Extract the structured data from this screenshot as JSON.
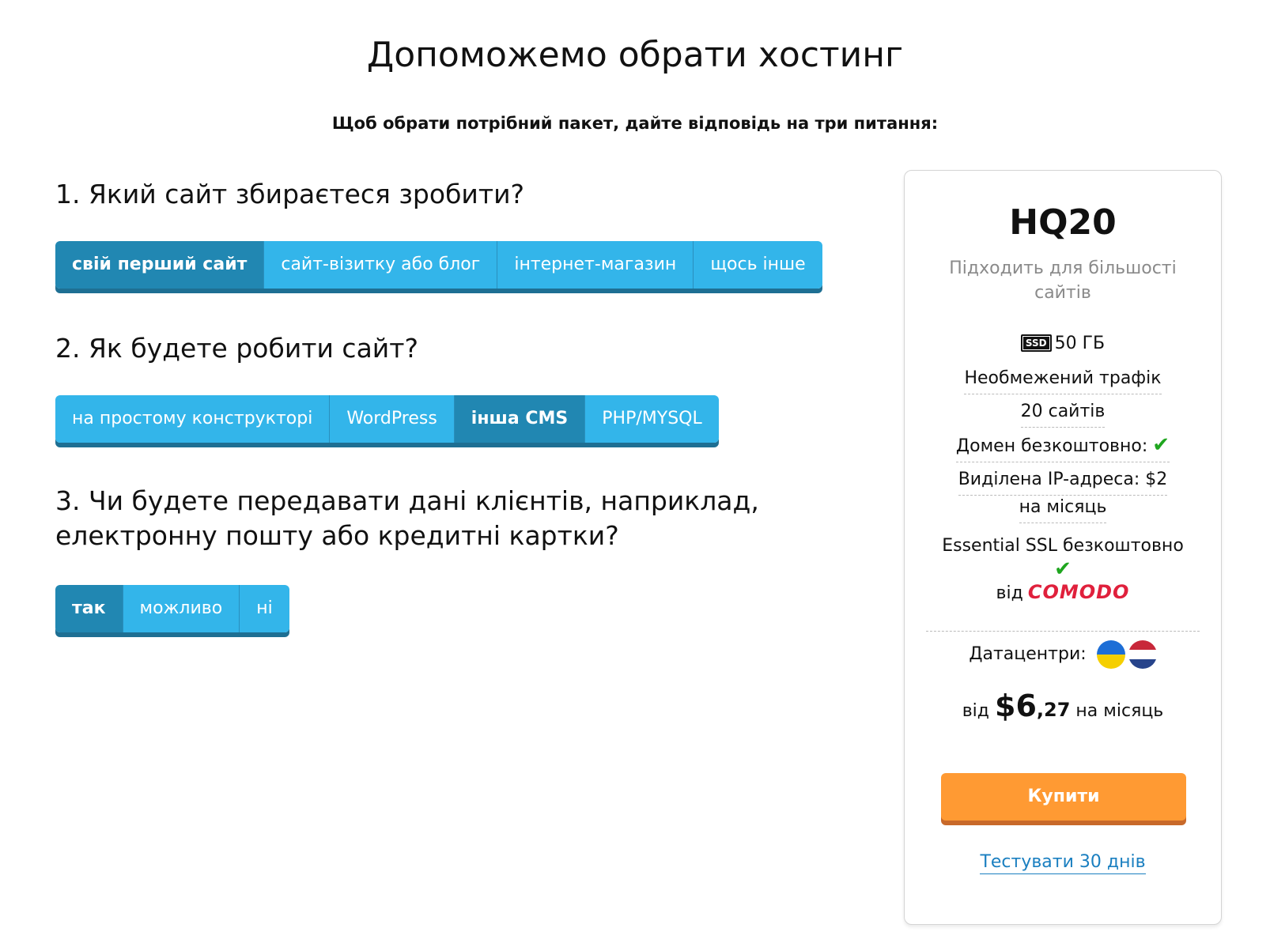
{
  "header": {
    "title": "Допоможемо обрати хостинг",
    "subtitle": "Щоб обрати потрібний пакет, дайте відповідь на три питання:"
  },
  "questions": [
    {
      "label": "1. Який сайт збираєтеся зробити?",
      "options": [
        "свій перший сайт",
        "сайт-візитку або блог",
        "інтернет-магазин",
        "щось інше"
      ],
      "selected": "свій перший сайт"
    },
    {
      "label": "2. Як будете робити сайт?",
      "options": [
        "на простому конструкторі",
        "WordPress",
        "інша CMS",
        "PHP/MYSQL"
      ],
      "selected": "інша CMS"
    },
    {
      "label": "3. Чи будете передавати дані клієнтів, наприклад, електронну пошту або кредитні картки?",
      "options": [
        "так",
        "можливо",
        "ні"
      ],
      "selected": "так"
    }
  ],
  "plan": {
    "name": "HQ20",
    "description": "Підходить для більшості сайтів",
    "ssd_badge": "SSD",
    "storage": "50 ГБ",
    "traffic": "Необмежений трафік",
    "sites": "20 сайтів",
    "domain": "Домен безкоштовно:",
    "ip_line1": "Виділена IP-адреса: $2",
    "ip_line2": "на місяць",
    "ssl": "Essential SSL безкоштовно",
    "ssl_from": "від",
    "ssl_brand": "COMODO",
    "datacenters": "Датацентри:",
    "price_prefix": "від",
    "price_int": "$6",
    "price_frac": ",27",
    "price_suffix": "на місяць",
    "buy_label": "Купити",
    "trial_label": "Тестувати 30 днів"
  },
  "icons": {
    "check": "check-icon",
    "ua_flag": "ukraine-flag-icon",
    "nl_flag": "netherlands-flag-icon"
  },
  "colors": {
    "option_bg": "#33b5ea",
    "option_active_bg": "#2187b2",
    "buy_bg": "#ff9a33",
    "check": "#1fa61f",
    "comodo": "#e0203c",
    "link": "#1a7fc0"
  }
}
